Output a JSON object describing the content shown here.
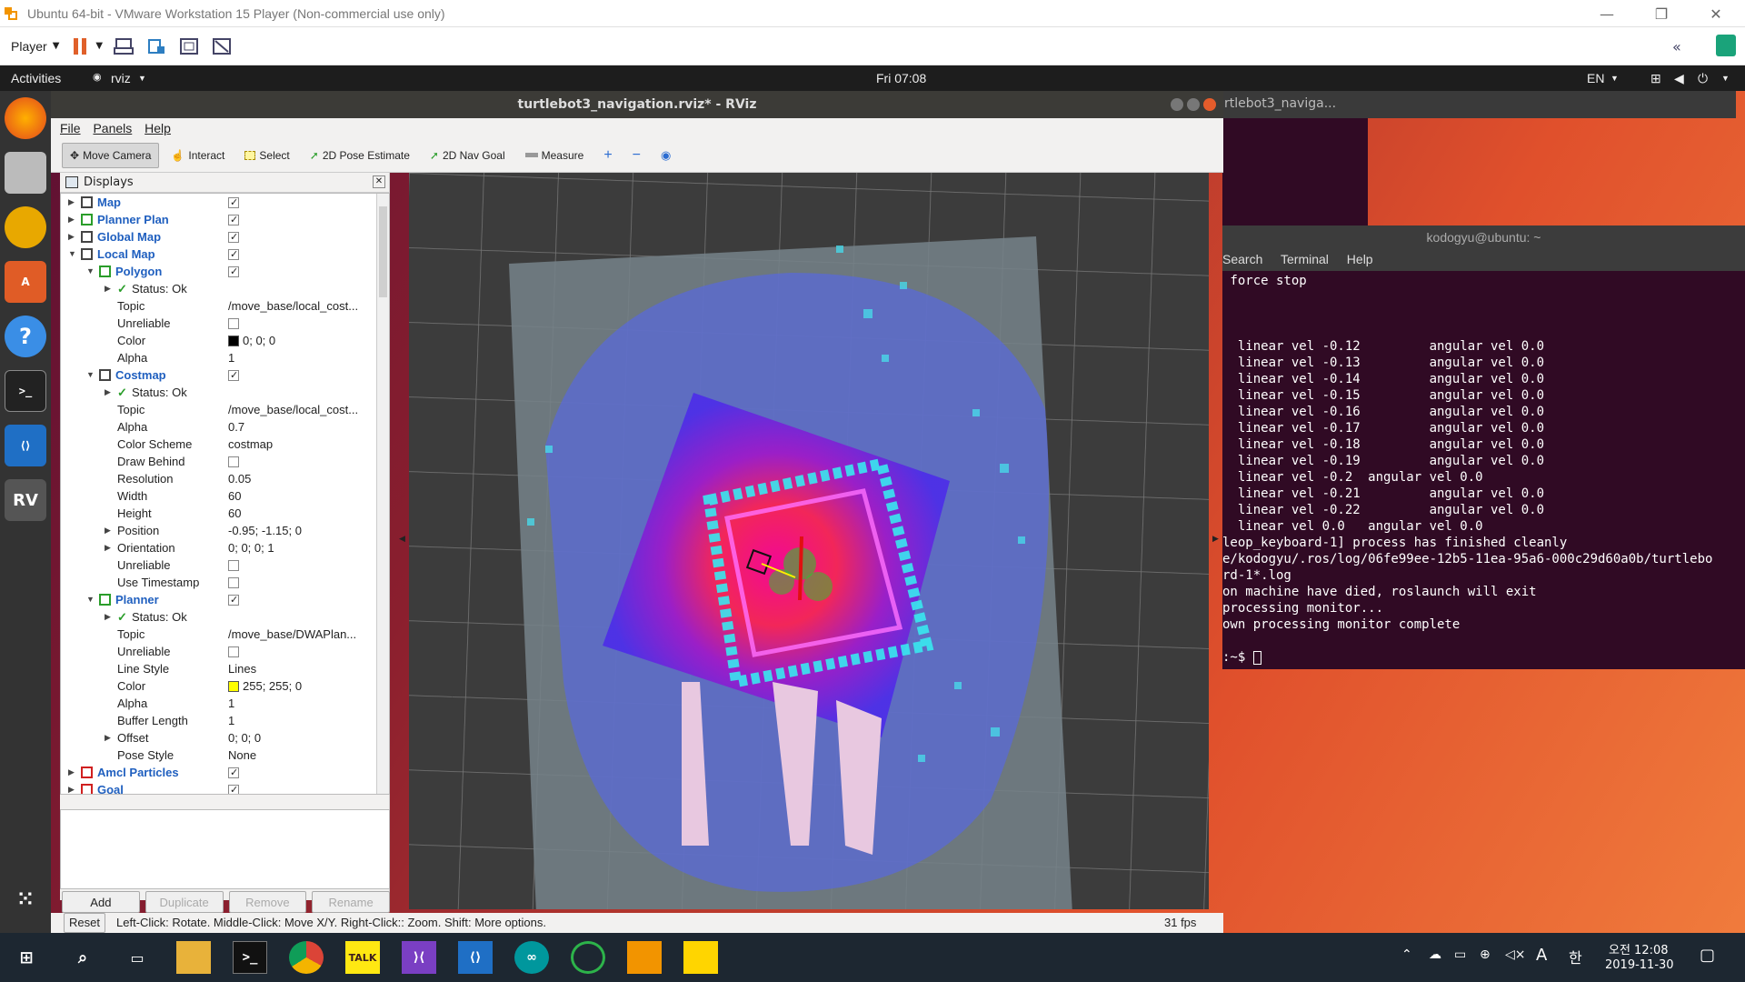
{
  "vm": {
    "title": "Ubuntu 64-bit - VMware Workstation 15 Player (Non-commercial use only)",
    "player_label": "Player",
    "toolbar_icons": [
      "pause-icon",
      "send-ctrl-alt-del-icon",
      "removable-devices-icon",
      "fit-guest-icon",
      "unity-icon"
    ]
  },
  "gnome": {
    "activities": "Activities",
    "app": "rviz",
    "clock": "Fri 07:08",
    "lang": "EN"
  },
  "rviz": {
    "title": "turtlebot3_navigation.rviz* - RViz",
    "menu": [
      "File",
      "Panels",
      "Help"
    ],
    "tools": [
      "Move Camera",
      "Interact",
      "Select",
      "2D Pose Estimate",
      "2D Nav Goal",
      "Measure"
    ],
    "panel_title": "Displays",
    "rows": [
      {
        "name": "Map",
        "kind": "cat",
        "level": 0,
        "arrow": "right",
        "check": true
      },
      {
        "name": "Planner Plan",
        "kind": "cat",
        "level": 0,
        "arrow": "right",
        "check": true
      },
      {
        "name": "Global Map",
        "kind": "cat",
        "level": 0,
        "arrow": "right",
        "check": true
      },
      {
        "name": "Local Map",
        "kind": "cat",
        "level": 0,
        "arrow": "down",
        "check": true
      },
      {
        "name": "Polygon",
        "kind": "cat",
        "level": 1,
        "arrow": "down",
        "check": true
      },
      {
        "name": "Status: Ok",
        "kind": "status",
        "level": 2,
        "arrow": "right"
      },
      {
        "name": "Topic",
        "kind": "prop",
        "level": 2,
        "value": "/move_base/local_cost..."
      },
      {
        "name": "Unreliable",
        "kind": "prop",
        "level": 2,
        "check": false
      },
      {
        "name": "Color",
        "kind": "prop",
        "level": 2,
        "value": "0; 0; 0",
        "swatch": "#000000"
      },
      {
        "name": "Alpha",
        "kind": "prop",
        "level": 2,
        "value": "1"
      },
      {
        "name": "Costmap",
        "kind": "cat",
        "level": 1,
        "arrow": "down",
        "check": true
      },
      {
        "name": "Status: Ok",
        "kind": "status",
        "level": 2,
        "arrow": "right"
      },
      {
        "name": "Topic",
        "kind": "prop",
        "level": 2,
        "value": "/move_base/local_cost..."
      },
      {
        "name": "Alpha",
        "kind": "prop",
        "level": 2,
        "value": "0.7"
      },
      {
        "name": "Color Scheme",
        "kind": "prop",
        "level": 2,
        "value": "costmap"
      },
      {
        "name": "Draw Behind",
        "kind": "prop",
        "level": 2,
        "check": false
      },
      {
        "name": "Resolution",
        "kind": "prop",
        "level": 2,
        "value": "0.05"
      },
      {
        "name": "Width",
        "kind": "prop",
        "level": 2,
        "value": "60"
      },
      {
        "name": "Height",
        "kind": "prop",
        "level": 2,
        "value": "60"
      },
      {
        "name": "Position",
        "kind": "prop",
        "level": 2,
        "arrow": "right",
        "value": "-0.95; -1.15; 0"
      },
      {
        "name": "Orientation",
        "kind": "prop",
        "level": 2,
        "arrow": "right",
        "value": "0; 0; 0; 1"
      },
      {
        "name": "Unreliable",
        "kind": "prop",
        "level": 2,
        "check": false
      },
      {
        "name": "Use Timestamp",
        "kind": "prop",
        "level": 2,
        "check": false
      },
      {
        "name": "Planner",
        "kind": "cat",
        "level": 1,
        "arrow": "down",
        "check": true
      },
      {
        "name": "Status: Ok",
        "kind": "status",
        "level": 2,
        "arrow": "right"
      },
      {
        "name": "Topic",
        "kind": "prop",
        "level": 2,
        "value": "/move_base/DWAPlan..."
      },
      {
        "name": "Unreliable",
        "kind": "prop",
        "level": 2,
        "check": false
      },
      {
        "name": "Line Style",
        "kind": "prop",
        "level": 2,
        "value": "Lines"
      },
      {
        "name": "Color",
        "kind": "prop",
        "level": 2,
        "value": "255; 255; 0",
        "swatch": "#ffff00"
      },
      {
        "name": "Alpha",
        "kind": "prop",
        "level": 2,
        "value": "1"
      },
      {
        "name": "Buffer Length",
        "kind": "prop",
        "level": 2,
        "value": "1"
      },
      {
        "name": "Offset",
        "kind": "prop",
        "level": 2,
        "arrow": "right",
        "value": "0; 0; 0"
      },
      {
        "name": "Pose Style",
        "kind": "prop",
        "level": 2,
        "value": "None"
      },
      {
        "name": "Amcl Particles",
        "kind": "cat",
        "level": 0,
        "arrow": "right",
        "check": true
      },
      {
        "name": "Goal",
        "kind": "cat",
        "level": 0,
        "arrow": "right",
        "check": true
      }
    ],
    "buttons": {
      "add": "Add",
      "duplicate": "Duplicate",
      "remove": "Remove",
      "rename": "Rename"
    },
    "status": {
      "reset": "Reset",
      "help": "Left-Click: Rotate. Middle-Click: Move X/Y. Right-Click:: Zoom. Shift: More options.",
      "fps": "31 fps"
    }
  },
  "terminal": {
    "title": "kodogyu@ubuntu: ~",
    "back_title": "rtlebot3_naviga...",
    "menu": [
      "Search",
      "Terminal",
      "Help"
    ],
    "lines": [
      " force stop",
      "",
      "",
      "",
      "  linear vel -0.12         angular vel 0.0",
      "  linear vel -0.13         angular vel 0.0",
      "  linear vel -0.14         angular vel 0.0",
      "  linear vel -0.15         angular vel 0.0",
      "  linear vel -0.16         angular vel 0.0",
      "  linear vel -0.17         angular vel 0.0",
      "  linear vel -0.18         angular vel 0.0",
      "  linear vel -0.19         angular vel 0.0",
      "  linear vel -0.2  angular vel 0.0",
      "  linear vel -0.21         angular vel 0.0",
      "  linear vel -0.22         angular vel 0.0",
      "  linear vel 0.0   angular vel 0.0",
      "leop_keyboard-1] process has finished cleanly",
      "e/kodogyu/.ros/log/06fe99ee-12b5-11ea-95a6-000c29d60a0b/turtlebo",
      "rd-1*.log",
      "on machine have died, roslaunch will exit",
      "processing monitor...",
      "own processing monitor complete",
      "",
      ":~$ "
    ]
  },
  "taskbar": {
    "time": "오전 12:08",
    "date": "2019-11-30",
    "ime": "A",
    "lang": "한"
  },
  "colors": {
    "rviz_cat": "#1f5fbf",
    "terminal_bg": "#300a24",
    "taskbar": "#1d2731"
  }
}
